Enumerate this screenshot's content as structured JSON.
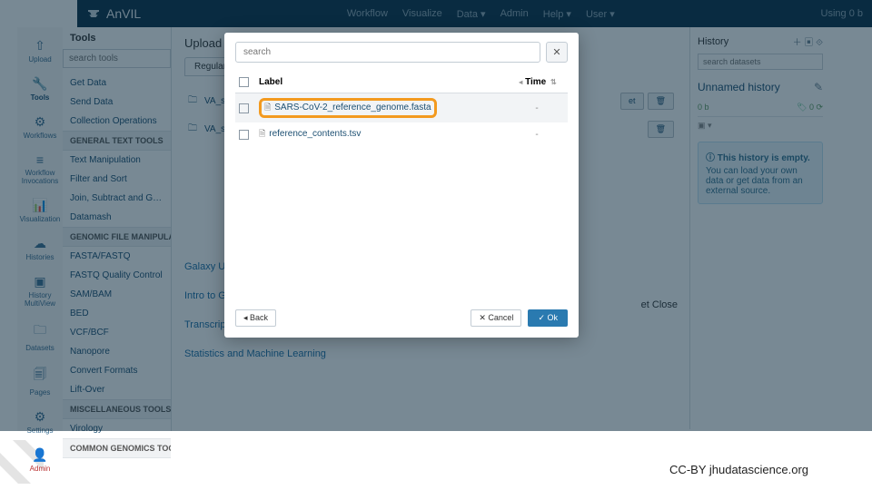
{
  "topnav": {
    "brand": "AnVIL",
    "items": [
      "Workflow",
      "Visualize",
      "Data ▾",
      "Admin",
      "Help ▾",
      "User ▾"
    ],
    "right": "Using 0 b"
  },
  "rail": [
    {
      "icon": "⇧",
      "label": "Upload"
    },
    {
      "icon": "🔧",
      "label": "Tools",
      "active": true
    },
    {
      "icon": "⚙",
      "label": "Workflows"
    },
    {
      "icon": "≡",
      "label": "Workflow Invocations"
    },
    {
      "icon": "📊",
      "label": "Visualization"
    },
    {
      "icon": "☁",
      "label": "Histories"
    },
    {
      "icon": "▣",
      "label": "History MultiView"
    },
    {
      "icon": "🗀",
      "label": "Datasets"
    },
    {
      "icon": "🗐",
      "label": "Pages"
    },
    {
      "icon": "⚙",
      "label": "Settings"
    },
    {
      "icon": "👤",
      "label": "Admin",
      "red": true
    }
  ],
  "tools": {
    "header": "Tools",
    "search_placeholder": "search tools",
    "items": [
      {
        "label": "Get Data"
      },
      {
        "label": "Send Data"
      },
      {
        "label": "Collection Operations"
      },
      {
        "label": "GENERAL TEXT TOOLS",
        "section": true
      },
      {
        "label": "Text Manipulation"
      },
      {
        "label": "Filter and Sort"
      },
      {
        "label": "Join, Subtract and Group"
      },
      {
        "label": "Datamash"
      },
      {
        "label": "GENOMIC FILE MANIPULAT",
        "section": true
      },
      {
        "label": "FASTA/FASTQ"
      },
      {
        "label": "FASTQ Quality Control"
      },
      {
        "label": "SAM/BAM"
      },
      {
        "label": "BED"
      },
      {
        "label": "VCF/BCF"
      },
      {
        "label": "Nanopore"
      },
      {
        "label": "Convert Formats"
      },
      {
        "label": "Lift-Over"
      },
      {
        "label": "MISCELLANEOUS TOOLS",
        "section": true
      },
      {
        "label": "Virology"
      },
      {
        "label": "COMMON GENOMICS TOOLS",
        "section": true
      }
    ]
  },
  "main": {
    "upload_from": "Upload from",
    "tabs": [
      "Regular"
    ],
    "files": [
      {
        "name": "VA_s",
        "start_btn": "et",
        "close_btn": "Close"
      },
      {
        "name": "VA_s"
      }
    ],
    "links": [
      "Galaxy UI training",
      "Intro to Galaxy Analysis",
      "Transcriptomics",
      "Statistics and Machine Learning"
    ]
  },
  "history": {
    "header": "History",
    "search_placeholder": "search datasets",
    "title": "Unnamed history",
    "size": "0 b",
    "status": "0",
    "tags": "▣ ▾",
    "empty_title": "ⓘ This history is empty.",
    "empty_body": "You can load your own data or get data from an external source."
  },
  "modal": {
    "search_placeholder": "search",
    "col_label": "Label",
    "col_time": "Time",
    "rows": [
      {
        "name": "SARS-CoV-2_reference_genome.fasta",
        "time": "-",
        "highlighted": true
      },
      {
        "name": "reference_contents.tsv",
        "time": "-"
      }
    ],
    "back": "◂ Back",
    "cancel": "✕ Cancel",
    "ok": "✓ Ok"
  },
  "attribution": "CC-BY  jhudatascience.org"
}
